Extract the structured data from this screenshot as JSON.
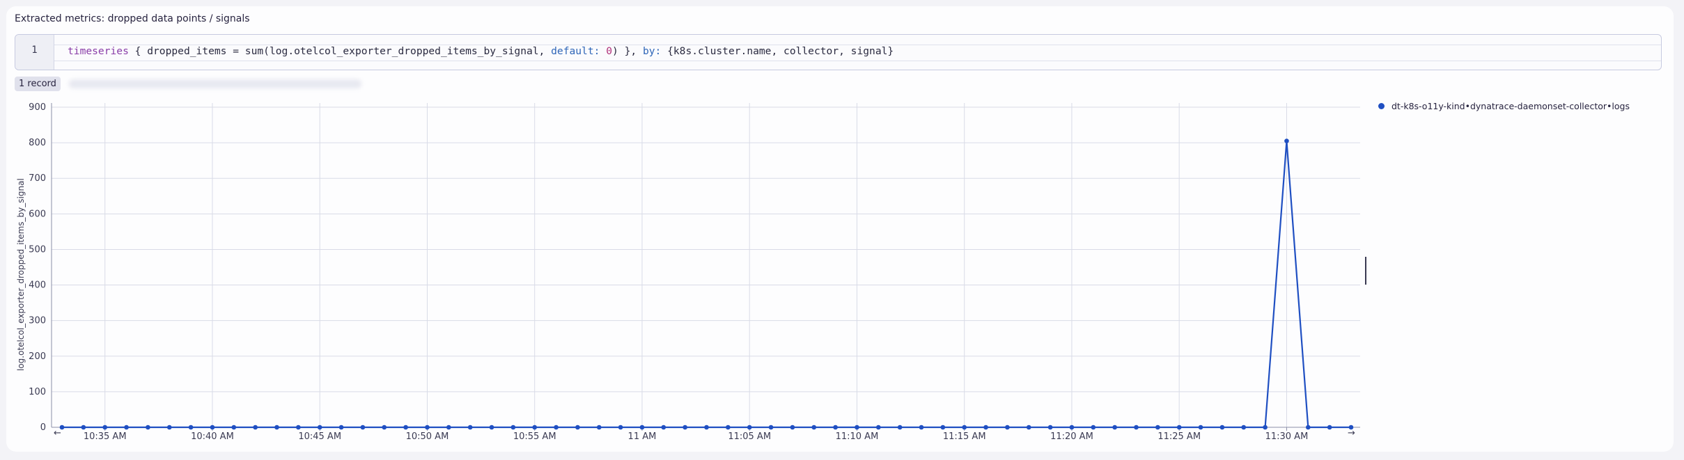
{
  "panel": {
    "title": "Extracted metrics: dropped data points / signals",
    "record_badge": "1 record"
  },
  "editor": {
    "line_number": "1",
    "query_parts": {
      "kw": "timeseries",
      "p1": " { dropped_items = sum(log.otelcol_exporter_dropped_items_by_signal, ",
      "default_key": "default:",
      "space": " ",
      "default_val": "0",
      "p2": ") }, ",
      "by_key": "by:",
      "p3": " {k8s.cluster.name, collector, signal}"
    }
  },
  "chart_data": {
    "type": "line",
    "ylabel": "log.otelcol_exporter_dropped_items_by_signal",
    "ylim": [
      0,
      900
    ],
    "yticks": [
      "0",
      "100",
      "200",
      "300",
      "400",
      "500",
      "600",
      "700",
      "800",
      "900"
    ],
    "xticks": [
      "10:35 AM",
      "10:40 AM",
      "10:45 AM",
      "10:50 AM",
      "10:55 AM",
      "11 AM",
      "11:05 AM",
      "11:10 AM",
      "11:15 AM",
      "11:20 AM",
      "11:25 AM",
      "11:30 AM"
    ],
    "x_start": "10:33 AM",
    "x_end": "11:34 AM",
    "x_step_minutes": 1,
    "series": [
      {
        "name": "dt-k8s-o11y-kind•dynatrace-daemonset-collector•logs",
        "color": "#1f4fc2",
        "values": [
          0,
          0,
          0,
          0,
          0,
          0,
          0,
          0,
          0,
          0,
          0,
          0,
          0,
          0,
          0,
          0,
          0,
          0,
          0,
          0,
          0,
          0,
          0,
          0,
          0,
          0,
          0,
          0,
          0,
          0,
          0,
          0,
          0,
          0,
          0,
          0,
          0,
          0,
          0,
          0,
          0,
          0,
          0,
          0,
          0,
          0,
          0,
          0,
          0,
          0,
          0,
          0,
          0,
          0,
          0,
          0,
          0,
          805,
          0,
          0,
          0
        ]
      }
    ]
  },
  "nav": {
    "left_arrow": "←",
    "right_arrow": "→"
  }
}
